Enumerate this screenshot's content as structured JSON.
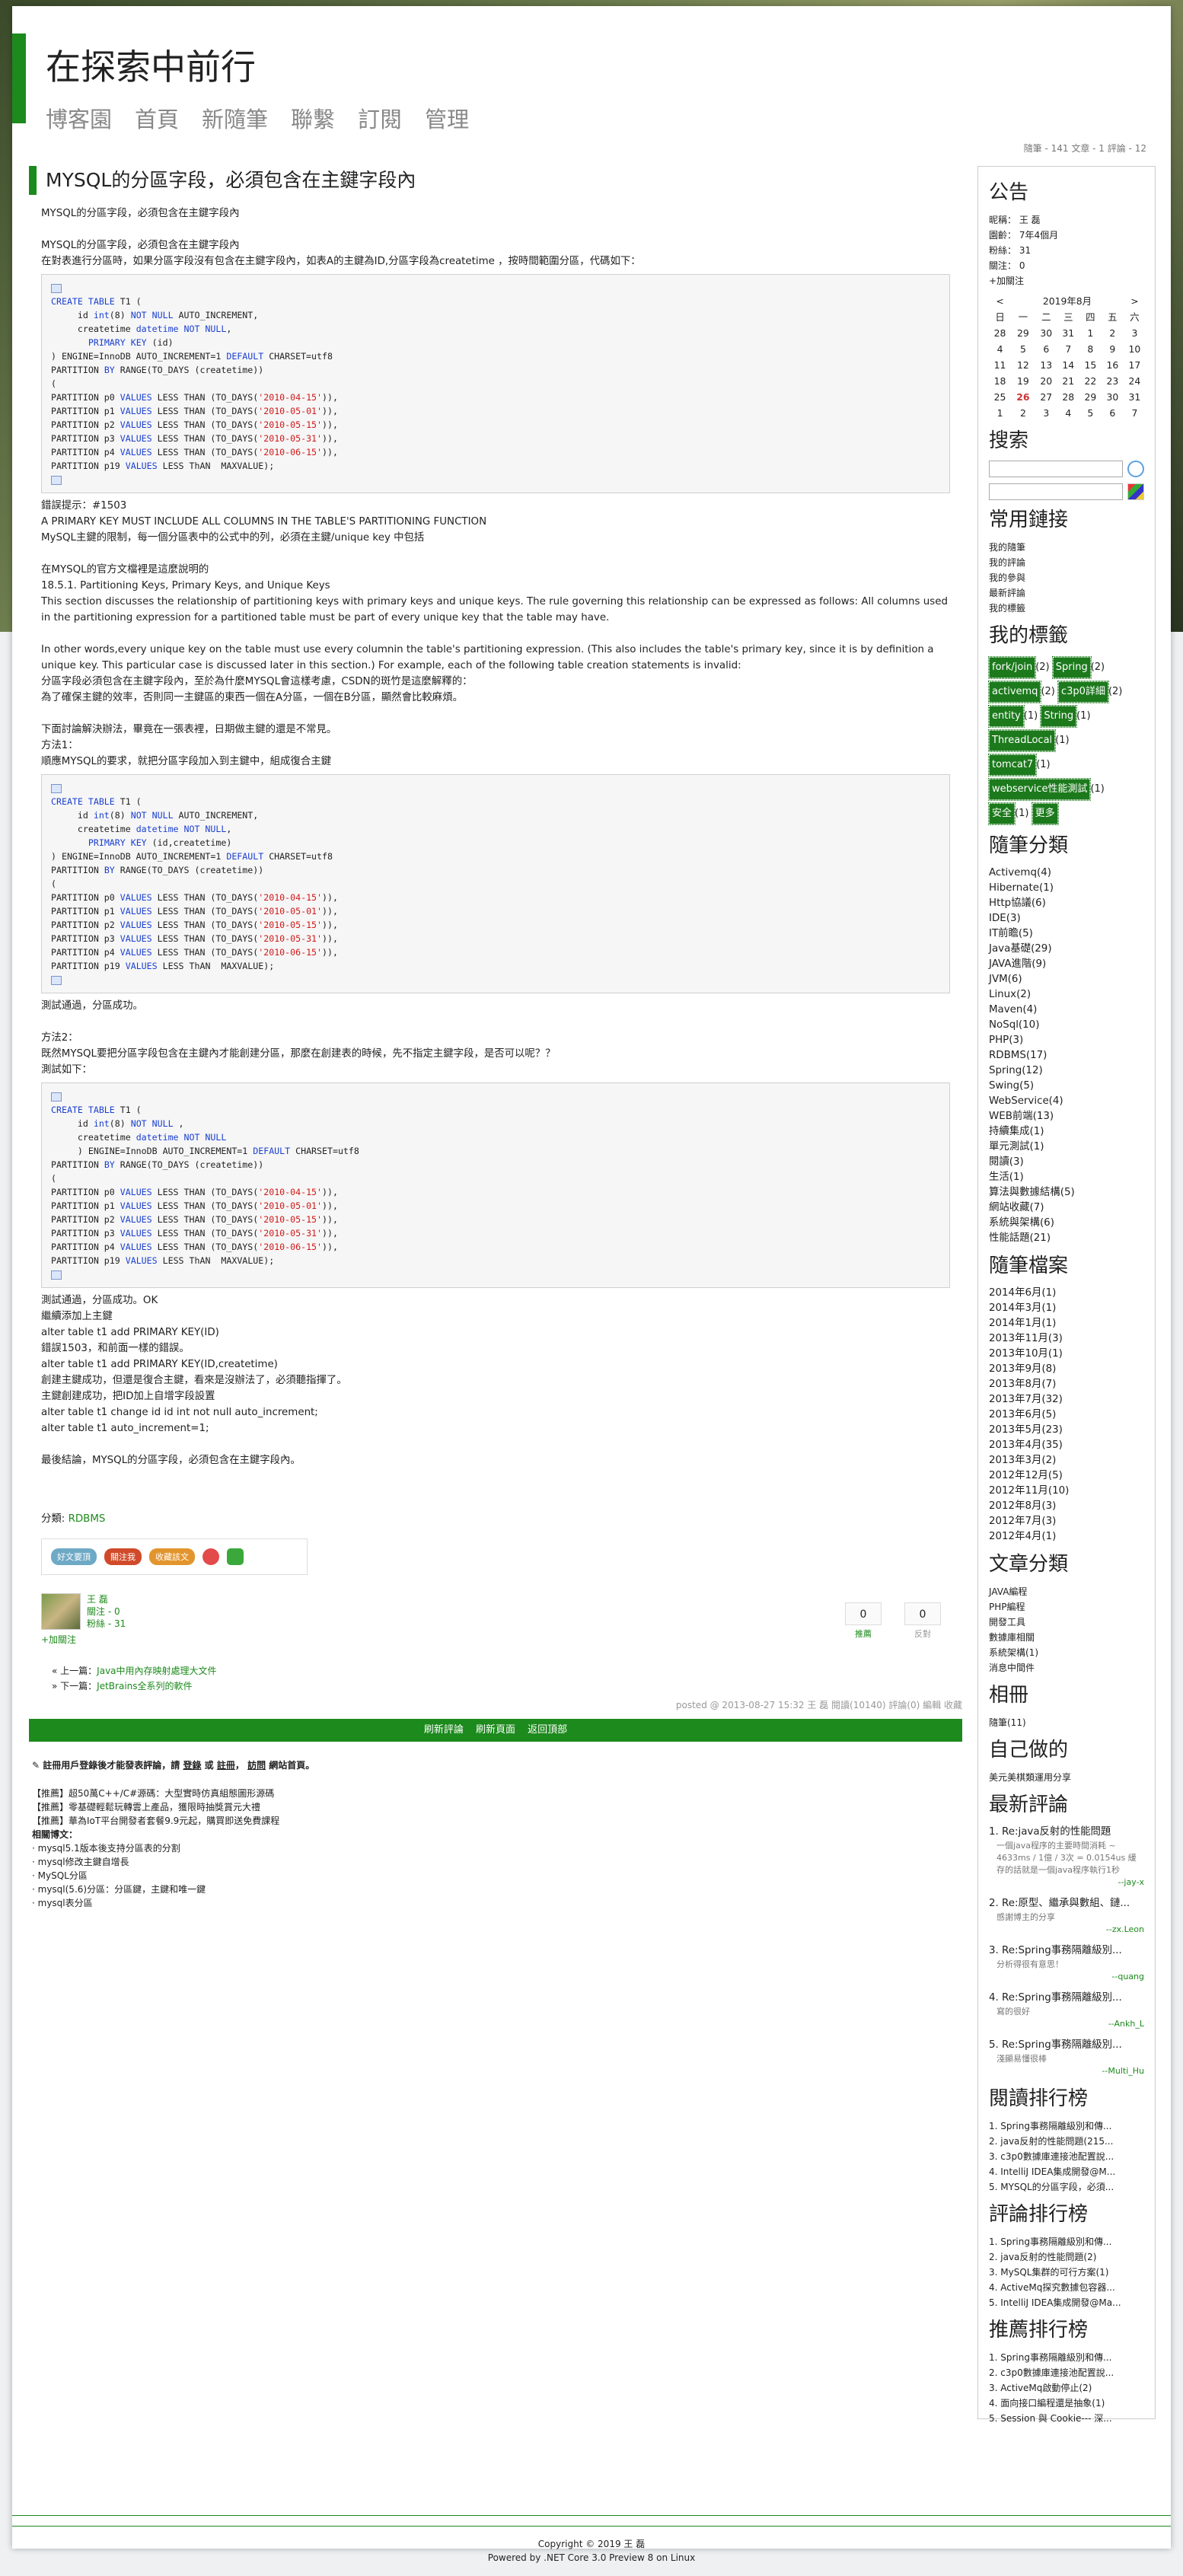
{
  "header": {
    "blog_title": "在探索中前行",
    "nav": [
      "博客園",
      "首頁",
      "新隨筆",
      "聯繫",
      "訂閱",
      "管理"
    ],
    "stats": "隨筆 - 141  文章 - 1  評論 - 12"
  },
  "post": {
    "title": "MYSQL的分區字段，必須包含在主鍵字段內",
    "intro1": "MYSQL的分區字段，必須包含在主鍵字段內",
    "intro2": "MYSQL的分區字段，必須包含在主鍵字段內",
    "intro3": "在對表進行分區時，如果分區字段沒有包含在主鍵字段內，如表A的主鍵為ID,分區字段為createtime ，按時間範圍分區，代碼如下：",
    "code1": [
      "CREATE TABLE T1 (",
      "     id int(8) NOT NULL AUTO_INCREMENT,",
      "     createtime datetime NOT NULL,",
      "       PRIMARY KEY (id)",
      ") ENGINE=InnoDB AUTO_INCREMENT=1 DEFAULT CHARSET=utf8",
      "PARTITION BY RANGE(TO_DAYS (createtime))",
      "(",
      "PARTITION p0 VALUES LESS THAN (TO_DAYS('2010-04-15')),",
      "PARTITION p1 VALUES LESS THAN (TO_DAYS('2010-05-01')),",
      "PARTITION p2 VALUES LESS THAN (TO_DAYS('2010-05-15')),",
      "PARTITION p3 VALUES LESS THAN (TO_DAYS('2010-05-31')),",
      "PARTITION p4 VALUES LESS THAN (TO_DAYS('2010-06-15')),",
      "PARTITION p19 VALUES LESS ThAN  MAXVALUE);"
    ],
    "err1": "錯誤提示：#1503",
    "err2": " A PRIMARY KEY MUST INCLUDE ALL COLUMNS IN THE TABLE'S PARTITIONING FUNCTION",
    "err3": "MySQL主鍵的限制，每一個分區表中的公式中的列，必須在主鍵/unique key 中包括",
    "doc1": "在MYSQL的官方文檔裡是這麼說明的",
    "doc2": "18.5.1. Partitioning Keys, Primary Keys, and Unique Keys",
    "doc3": "This section discusses the relationship of partitioning keys with primary keys and unique keys. The rule governing this relationship can be expressed as follows: All columns used in the partitioning expression for a partitioned table must be part of every unique key that the table may have.",
    "doc4": "In other words,every unique key on the table must use every columnin the table's partitioning expression. (This also includes the table's primary key, since it is by definition a unique key. This particular case is discussed later in this section.) For example, each of the following table creation statements is invalid:",
    "doc5": "分區字段必須包含在主鍵字段內，至於為什麼MYSQL會這樣考慮，CSDN的斑竹是這麼解釋的：",
    "doc6": "為了確保主鍵的效率，否則同一主鍵區的東西一個在A分區，一個在B分區，顯然會比較麻煩。",
    "m1a": "下面討論解決辦法，畢竟在一張表裡，日期做主鍵的還是不常見。",
    "m1b": "方法1：",
    "m1c": "順應MYSQL的要求，就把分區字段加入到主鍵中，組成復合主鍵",
    "code2": [
      "CREATE TABLE T1 (",
      "     id int(8) NOT NULL AUTO_INCREMENT,",
      "     createtime datetime NOT NULL,",
      "       PRIMARY KEY (id,createtime)",
      ") ENGINE=InnoDB AUTO_INCREMENT=1 DEFAULT CHARSET=utf8",
      "PARTITION BY RANGE(TO_DAYS (createtime))",
      "(",
      "PARTITION p0 VALUES LESS THAN (TO_DAYS('2010-04-15')),",
      "PARTITION p1 VALUES LESS THAN (TO_DAYS('2010-05-01')),",
      "PARTITION p2 VALUES LESS THAN (TO_DAYS('2010-05-15')),",
      "PARTITION p3 VALUES LESS THAN (TO_DAYS('2010-05-31')),",
      "PARTITION p4 VALUES LESS THAN (TO_DAYS('2010-06-15')),",
      "PARTITION p19 VALUES LESS ThAN  MAXVALUE);"
    ],
    "ok1": " 測試通過，分區成功。",
    "m2a": "方法2：",
    "m2b": "既然MYSQL要把分區字段包含在主鍵內才能創建分區，那麼在創建表的時候，先不指定主鍵字段，是否可以呢？？",
    "m2c": "測試如下：",
    "code3": [
      "CREATE TABLE T1 (",
      "     id int(8) NOT NULL ,",
      "     createtime datetime NOT NULL",
      "     ) ENGINE=InnoDB AUTO_INCREMENT=1 DEFAULT CHARSET=utf8",
      "PARTITION BY RANGE(TO_DAYS (createtime))",
      "(",
      "PARTITION p0 VALUES LESS THAN (TO_DAYS('2010-04-15')),",
      "PARTITION p1 VALUES LESS THAN (TO_DAYS('2010-05-01')),",
      "PARTITION p2 VALUES LESS THAN (TO_DAYS('2010-05-15')),",
      "PARTITION p3 VALUES LESS THAN (TO_DAYS('2010-05-31')),",
      "PARTITION p4 VALUES LESS THAN (TO_DAYS('2010-06-15')),",
      "PARTITION p19 VALUES LESS ThAN  MAXVALUE);"
    ],
    "t1": "測試通過，分區成功。OK",
    "t2": "繼續添加上主鍵",
    "t3": "alter table t1 add PRIMARY KEY(ID)",
    "t4": "錯誤1503，和前面一樣的錯誤。",
    "t5": "alter table t1 add PRIMARY KEY(ID,createtime)",
    "t6": "創建主鍵成功，但還是復合主鍵，看來是沒辦法了，必須聽指揮了。",
    "t7": "主鍵創建成功，把ID加上自增字段設置",
    "t8": "alter table t1 change id id int not null auto_increment;",
    "t9": "alter table t1 auto_increment=1;",
    "concl": "最後結論，MYSQL的分區字段，必須包含在主鍵字段內。",
    "cat_label": "分類:",
    "cat_value": "RDBMS",
    "share": [
      "好文要頂",
      "關注我",
      "收藏該文"
    ],
    "author_name": "王 磊",
    "author_follow": "關注 - 0",
    "author_fans": "粉絲 - 31",
    "add_follow": "+加關注",
    "vote_up": "0",
    "vote_up_label": "推薦",
    "vote_down": "0",
    "vote_down_label": "反對",
    "prev_label": "« 上一篇：",
    "prev_link": "Java中用內存映射處理大文件",
    "next_label": "» 下一篇：",
    "next_link": "JetBrains全系列的軟件",
    "posted": "posted @ 2013-08-27 15:32 王 磊 閱讀(10140) 評論(0) 編輯 收藏",
    "cbar": [
      "刷新評論",
      "刷新頁面",
      "返回頂部"
    ],
    "login_pre": "註冊用戶登錄後才能發表評論，請",
    "login_link": "登錄",
    "login_or": "或",
    "login_reg": "註冊",
    "login_visit": "訪問",
    "login_post": "網站首頁。",
    "ads": [
      "【推薦】超50萬C++/C#源碼：大型實時仿真組態圖形源碼",
      "【推薦】零基礎輕鬆玩轉雲上產品，獲限時抽獎賞元大禮",
      "【推薦】華為IoT平台開發者套餐9.9元起，購買即送免費課程"
    ],
    "related_title": "相關博文：",
    "related": [
      "· mysql5.1版本後支持分區表的分割",
      "· mysql修改主鍵自增長",
      "· MySQL分區",
      "· mysql(5.6)分區：分區鍵，主鍵和唯一鍵",
      "· mysql表分區"
    ]
  },
  "sidebar": {
    "notice_title": "公告",
    "notice": [
      "昵稱： 王 磊",
      "園齡： 7年4個月",
      "粉絲： 31",
      "關注： 0",
      "+加關注"
    ],
    "cal_title": "2019年8月",
    "cal_prev": "<",
    "cal_next": ">",
    "cal_head": [
      "日",
      "一",
      "二",
      "三",
      "四",
      "五",
      "六"
    ],
    "cal_rows": [
      [
        "28",
        "29",
        "30",
        "31",
        "1",
        "2",
        "3"
      ],
      [
        "4",
        "5",
        "6",
        "7",
        "8",
        "9",
        "10"
      ],
      [
        "11",
        "12",
        "13",
        "14",
        "15",
        "16",
        "17"
      ],
      [
        "18",
        "19",
        "20",
        "21",
        "22",
        "23",
        "24"
      ],
      [
        "25",
        "26",
        "27",
        "28",
        "29",
        "30",
        "31"
      ],
      [
        "1",
        "2",
        "3",
        "4",
        "5",
        "6",
        "7"
      ]
    ],
    "search_title": "搜索",
    "links_title": "常用鏈接",
    "links": [
      "我的隨筆",
      "我的評論",
      "我的參與",
      "最新評論",
      "我的標籤"
    ],
    "tags_title": "我的標籤",
    "tags": [
      "fork/join",
      "(2)",
      "Spring",
      "(2)",
      "activemq",
      "(2)",
      "c3p0詳細",
      "(2)",
      "entity",
      "(1)",
      "String",
      "(1)",
      "ThreadLocal",
      "(1)",
      "tomcat7",
      "(1)",
      "webservice性能測試",
      "(1)",
      "安全",
      "(1)",
      "更多"
    ],
    "cats_title": "隨筆分類",
    "cats": [
      "Activemq(4)",
      "Hibernate(1)",
      "Http協議(6)",
      "IDE(3)",
      "IT前瞻(5)",
      "Java基礎(29)",
      "JAVA進階(9)",
      "JVM(6)",
      "Linux(2)",
      "Maven(4)",
      "NoSql(10)",
      "PHP(3)",
      "RDBMS(17)",
      "Spring(12)",
      "Swing(5)",
      "WebService(4)",
      "WEB前端(13)",
      "持續集成(1)",
      "單元測試(1)",
      "閱讀(3)",
      "生活(1)",
      "算法與數據結構(5)",
      "網站收藏(7)",
      "系統與架構(6)",
      "性能話題(21)"
    ],
    "arch_title": "隨筆檔案",
    "arch": [
      "2014年6月(1)",
      "2014年3月(1)",
      "2014年1月(1)",
      "2013年11月(3)",
      "2013年10月(1)",
      "2013年9月(8)",
      "2013年8月(7)",
      "2013年7月(32)",
      "2013年6月(5)",
      "2013年5月(23)",
      "2013年4月(35)",
      "2013年3月(2)",
      "2012年12月(5)",
      "2012年11月(10)",
      "2012年8月(3)",
      "2012年7月(3)",
      "2012年4月(1)"
    ],
    "acat_title": "文章分類",
    "acat": [
      "JAVA編程",
      "PHP編程",
      "開發工具",
      "數據庫相關",
      "系統架構(1)",
      "消息中間件"
    ],
    "rel_title": "相冊",
    "rel": [
      "隨筆(11)"
    ],
    "self_title": "自己做的",
    "self": [
      "美元美棋類運用分享"
    ],
    "recent_title": "最新評論",
    "recent": [
      {
        "t": "1. Re:java反射的性能問題",
        "d": "一個java程序的主要時間消耗 ~ 4633ms / 1億 / 3次 = 0.0154us 緩存的話就是一個java程序執行1秒",
        "a": "--jay-x"
      },
      {
        "t": "2. Re:原型、繼承與數組、鏈...",
        "d": "感謝博主的分享",
        "a": "--zx.Leon"
      },
      {
        "t": "3. Re:Spring事務隔離級別...",
        "d": "分析得很有意思！",
        "a": "--quang"
      },
      {
        "t": "4. Re:Spring事務隔離級別...",
        "d": "寫的很好",
        "a": "--Ankh_L"
      },
      {
        "t": "5. Re:Spring事務隔離級別...",
        "d": "淺顯易懂很棒",
        "a": "--Multi_Hu"
      }
    ],
    "read_title": "閱讀排行榜",
    "read": [
      "1. Spring事務隔離級別和傳...",
      "2. java反射的性能問題(215...",
      "3. c3p0數據庫連接池配置說...",
      "4. IntelliJ IDEA集成開發@M...",
      "5. MYSQL的分區字段，必須..."
    ],
    "cmt_title": "評論排行榜",
    "cmt": [
      "1. Spring事務隔離級別和傳...",
      "2. java反射的性能問題(2)",
      "3. MySQL集群的可行方案(1)",
      "4. ActiveMq探究數據包容器...",
      "5. IntelliJ IDEA集成開發@Ma..."
    ],
    "rec_title": "推薦排行榜",
    "rec": [
      "1. Spring事務隔離級別和傳...",
      "2. c3p0數據庫連接池配置說...",
      "3. ActiveMq啟動停止(2)",
      "4. 面向接口編程還是抽象(1)",
      "5. Session 與 Cookie--- 深..."
    ]
  },
  "footer": {
    "copyright": "Copyright © 2019 王 磊",
    "powered": "Powered by .NET Core 3.0 Preview 8 on Linux"
  }
}
